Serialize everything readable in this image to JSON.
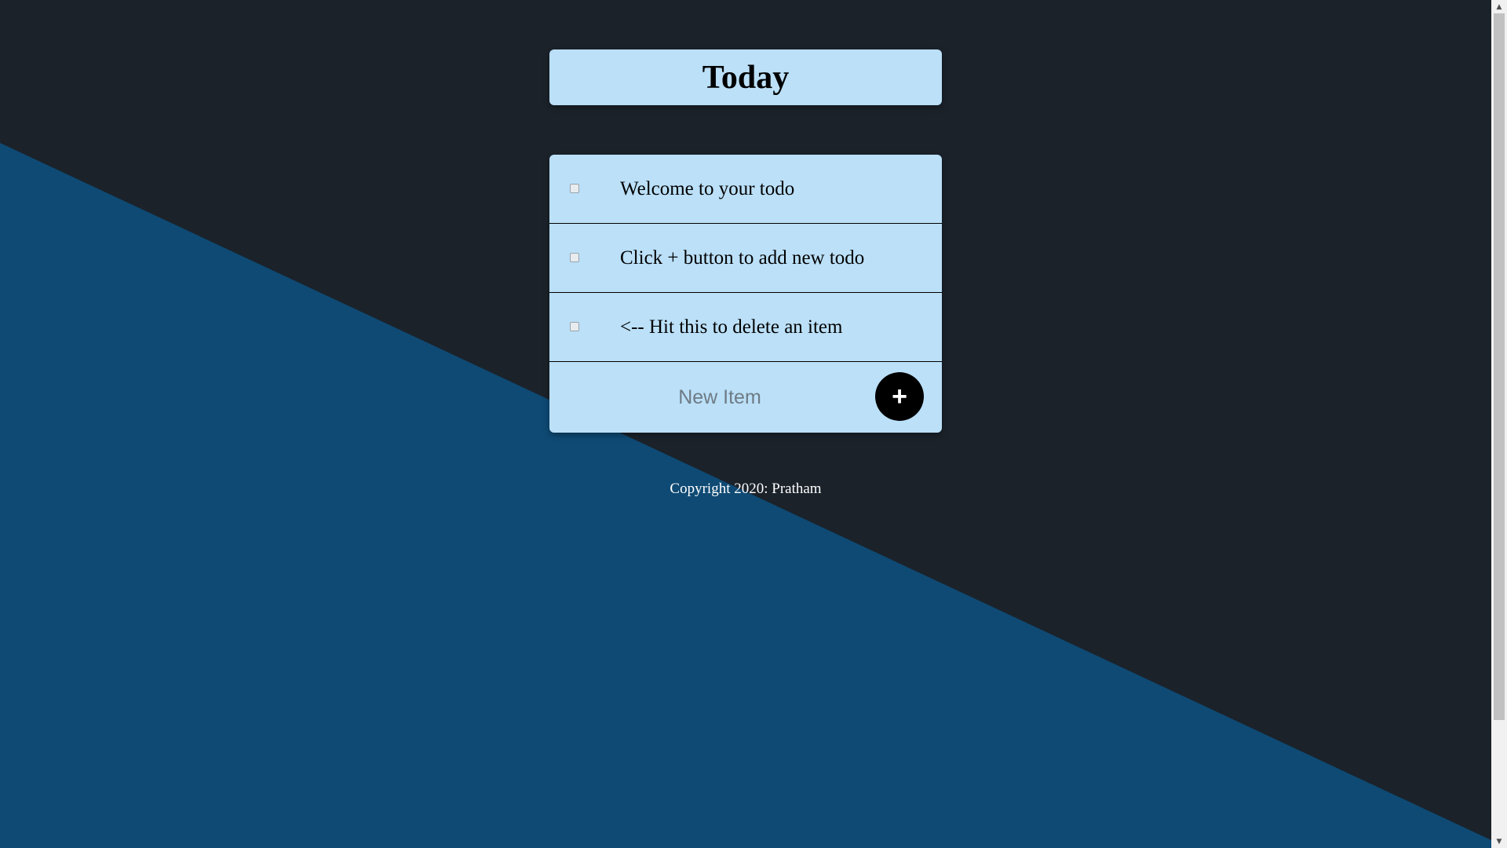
{
  "colors": {
    "background_dark": "#1b222a",
    "background_blue": "#0e4a74",
    "card": "#bbe0f8",
    "button": "#000000",
    "footer_text": "#ffffff"
  },
  "header": {
    "title": "Today"
  },
  "todo": {
    "items": [
      {
        "label": "Welcome to your todo",
        "checked": false
      },
      {
        "label": "Click + button to add new todo",
        "checked": false
      },
      {
        "label": "<-- Hit this to delete an item",
        "checked": false
      }
    ],
    "new_item": {
      "placeholder": "New Item",
      "value": ""
    },
    "add_button_label": "+"
  },
  "footer": {
    "text": "Copyright 2020: Pratham"
  },
  "scrollbar": {
    "up_icon": "chevron-up-icon",
    "down_icon": "chevron-down-icon"
  }
}
